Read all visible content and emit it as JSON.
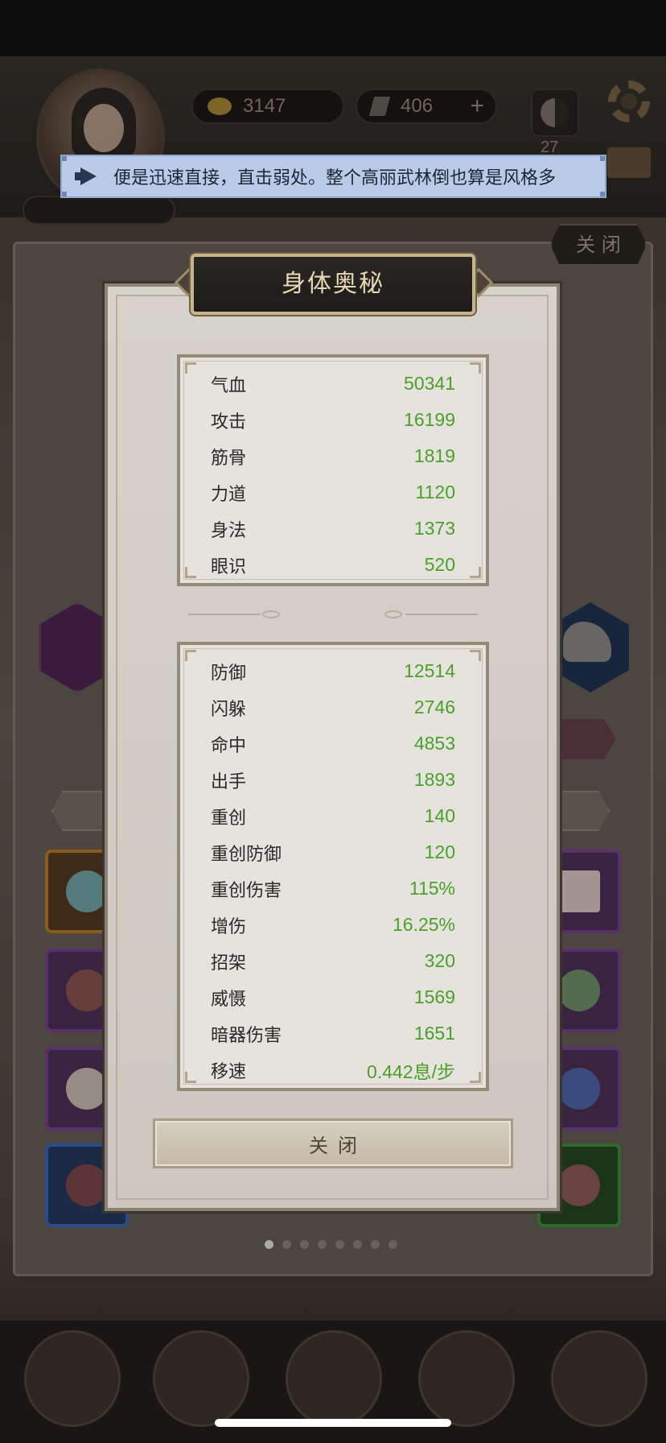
{
  "notice": {
    "text": "便是迅速直接，直击弱处。整个高丽武林倒也算是风格多"
  },
  "background": {
    "gold_value": "3147",
    "jade_value": "406",
    "taiji_count": "27",
    "close_label": "关 闭"
  },
  "modal": {
    "title": "身体奥秘",
    "primary_stats": [
      {
        "label": "气血",
        "value": "50341"
      },
      {
        "label": "攻击",
        "value": "16199"
      },
      {
        "label": "筋骨",
        "value": "1819"
      },
      {
        "label": "力道",
        "value": "1120"
      },
      {
        "label": "身法",
        "value": "1373"
      },
      {
        "label": "眼识",
        "value": "520"
      }
    ],
    "secondary_stats": [
      {
        "label": "防御",
        "value": "12514"
      },
      {
        "label": "闪躲",
        "value": "2746"
      },
      {
        "label": "命中",
        "value": "4853"
      },
      {
        "label": "出手",
        "value": "1893"
      },
      {
        "label": "重创",
        "value": "140"
      },
      {
        "label": "重创防御",
        "value": "120"
      },
      {
        "label": "重创伤害",
        "value": "115%"
      },
      {
        "label": "增伤",
        "value": "16.25%"
      },
      {
        "label": "招架",
        "value": "320"
      },
      {
        "label": "威慑",
        "value": "1569"
      },
      {
        "label": "暗器伤害",
        "value": "1651"
      },
      {
        "label": "移速",
        "value": "0.442息/步"
      }
    ],
    "close_button": "关闭"
  },
  "colors": {
    "stat_value": "#4aa129",
    "notice_bg": "#b9cbe8",
    "title_text": "#e8d7b4"
  }
}
